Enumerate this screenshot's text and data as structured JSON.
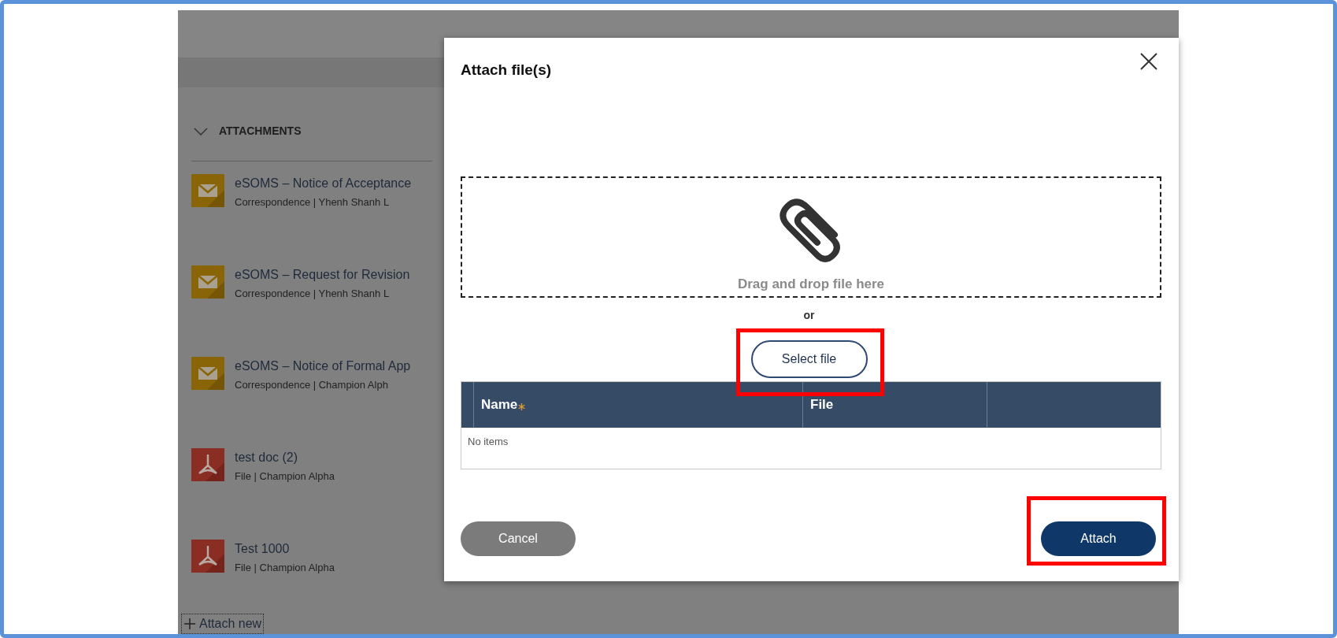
{
  "attachments_panel": {
    "title": "ATTACHMENTS",
    "expanded": true,
    "items": [
      {
        "kind": "correspondence",
        "title": "eSOMS – Notice of Acceptance",
        "meta": "Correspondence | Yhenh Shanh L"
      },
      {
        "kind": "correspondence",
        "title": "eSOMS – Request for Revision",
        "meta": "Correspondence | Yhenh Shanh L"
      },
      {
        "kind": "correspondence",
        "title": "eSOMS – Notice of Formal App",
        "meta": "Correspondence | Champion Alph"
      },
      {
        "kind": "pdf",
        "title": "test doc (2)",
        "meta": "File | Champion Alpha"
      },
      {
        "kind": "pdf",
        "title": "Test 1000",
        "meta": "File | Champion Alpha"
      }
    ],
    "attach_new": "Attach new"
  },
  "dialog": {
    "title": "Attach file(s)",
    "dropzone_text": "Drag and drop file here",
    "or_text": "or",
    "select_button": "Select file",
    "table": {
      "columns": [
        {
          "label": "Name",
          "required": true
        },
        {
          "label": "File",
          "required": false
        }
      ],
      "empty_text": "No items"
    },
    "buttons": [
      {
        "label": "Cancel",
        "kind": "secondary"
      },
      {
        "label": "Attach",
        "kind": "primary"
      }
    ]
  }
}
